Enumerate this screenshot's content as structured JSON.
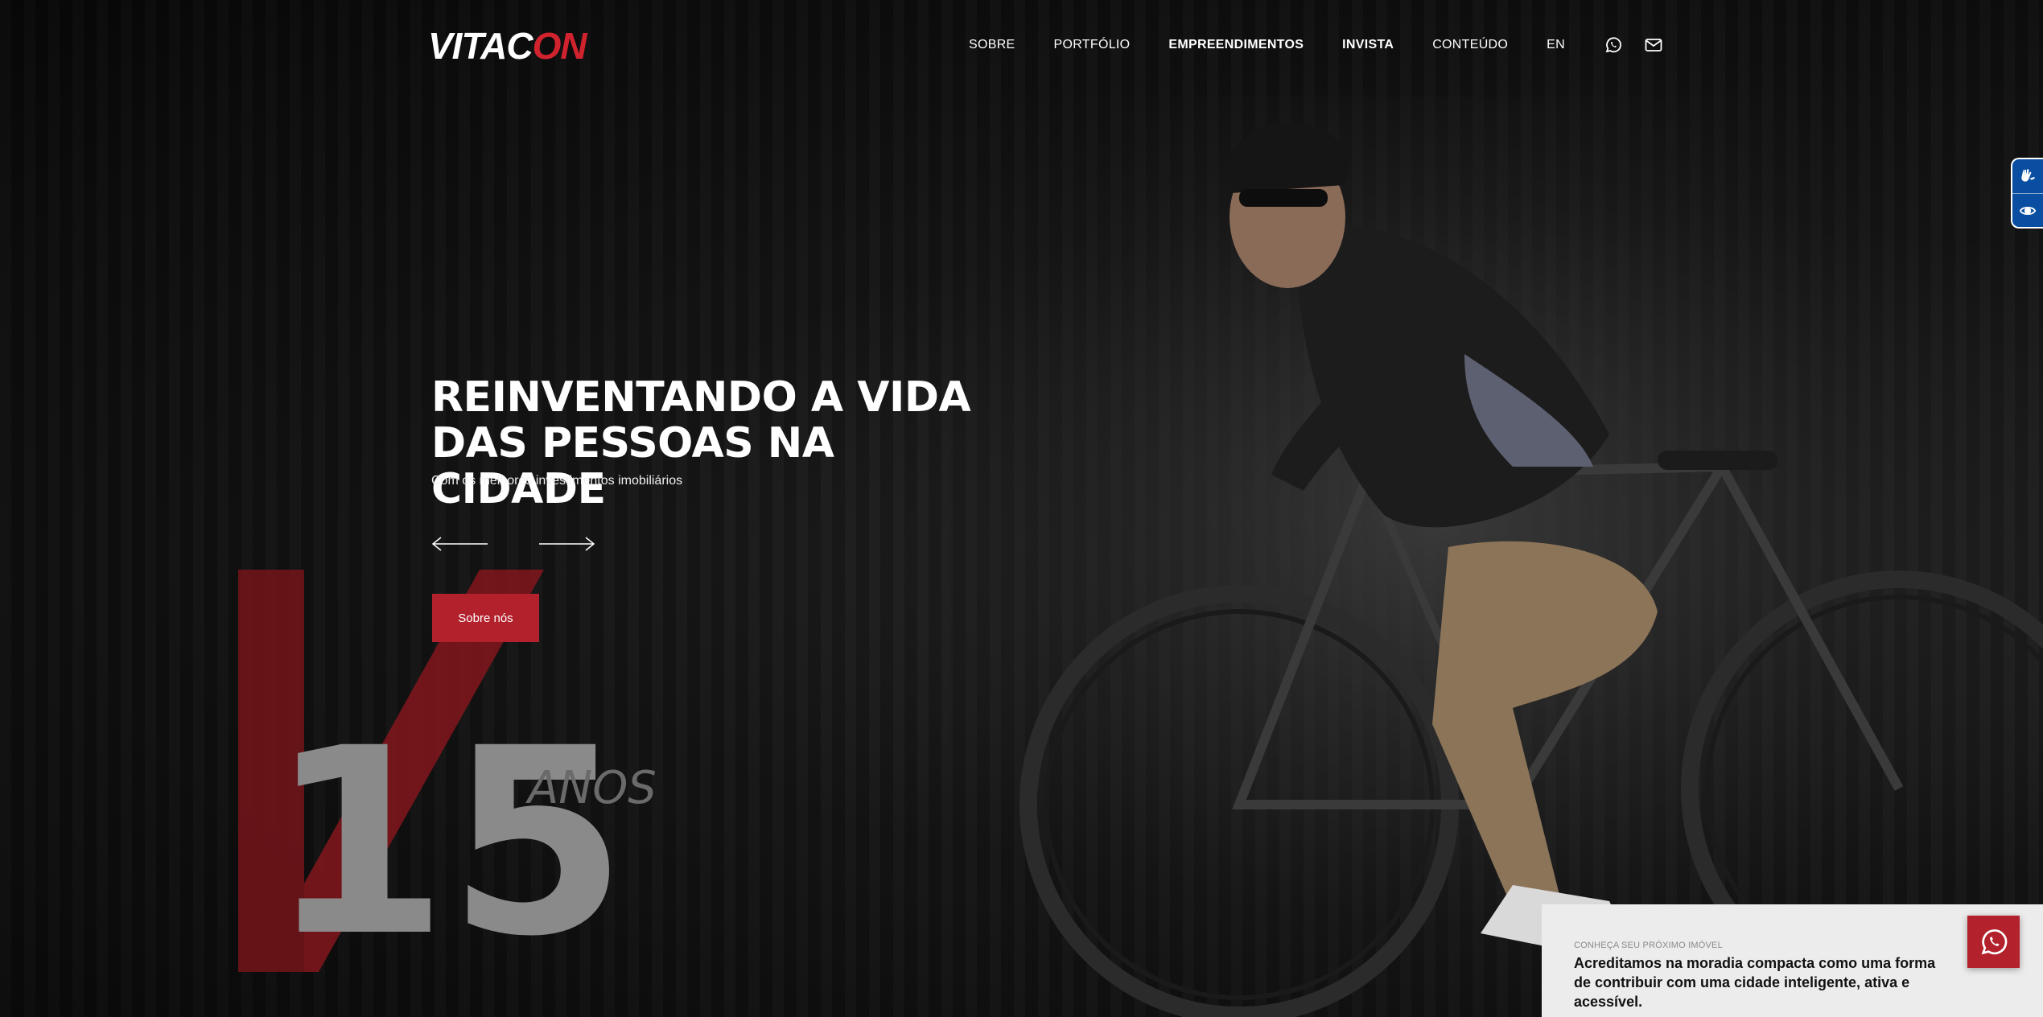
{
  "header": {
    "logo": {
      "part1": "VITAC",
      "part2": "ON"
    },
    "nav": [
      {
        "label": "SOBRE",
        "bold": false
      },
      {
        "label": "PORTFÓLIO",
        "bold": false
      },
      {
        "label": "EMPREENDIMENTOS",
        "bold": true
      },
      {
        "label": "INVISTA",
        "bold": true
      },
      {
        "label": "CONTEÚDO",
        "bold": false
      },
      {
        "label": "EN",
        "bold": false
      }
    ],
    "icons": [
      "whatsapp-icon",
      "mail-icon"
    ]
  },
  "accessibility": {
    "icons": [
      "sign-language-icon",
      "eye-icon"
    ],
    "accent": "#0a4ea1"
  },
  "hero": {
    "title_line1": "REINVENTANDO A VIDA",
    "title_line2": "DAS PESSOAS NA CIDADE",
    "subtitle": "Com os melhores investimentos imobiliários",
    "cta_label": "Sobre nós"
  },
  "badge": {
    "number": "15",
    "label": "ANOS"
  },
  "card": {
    "eyebrow": "CONHEÇA SEU PRÓXIMO IMÓVEL",
    "message": "Acreditamos na moradia compacta como uma forma de contribuir com uma cidade inteligente, ativa e acessível."
  },
  "colors": {
    "brand_red": "#b2212c",
    "logo_red": "#d0232e"
  }
}
